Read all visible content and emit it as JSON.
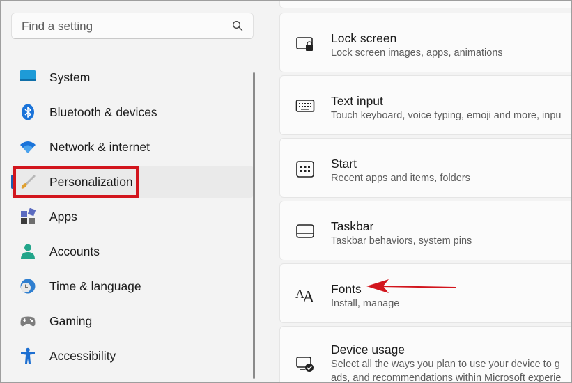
{
  "search": {
    "placeholder": "Find a setting"
  },
  "sidebar": {
    "items": [
      {
        "label": "System"
      },
      {
        "label": "Bluetooth & devices"
      },
      {
        "label": "Network & internet"
      },
      {
        "label": "Personalization",
        "selected": true
      },
      {
        "label": "Apps"
      },
      {
        "label": "Accounts"
      },
      {
        "label": "Time & language"
      },
      {
        "label": "Gaming"
      },
      {
        "label": "Accessibility"
      }
    ]
  },
  "settings": [
    {
      "title": "Lock screen",
      "subtitle": "Lock screen images, apps, animations"
    },
    {
      "title": "Text input",
      "subtitle": "Touch keyboard, voice typing, emoji and more, inpu"
    },
    {
      "title": "Start",
      "subtitle": "Recent apps and items, folders"
    },
    {
      "title": "Taskbar",
      "subtitle": "Taskbar behaviors, system pins"
    },
    {
      "title": "Fonts",
      "subtitle": "Install, manage"
    },
    {
      "title": "Device usage",
      "subtitle": "Select all the ways you plan to use your device to g",
      "subtitle2": "ads, and recommendations within Microsoft experie"
    }
  ],
  "colors": {
    "accent": "#1a5fb4",
    "annotation": "#d2151d"
  }
}
